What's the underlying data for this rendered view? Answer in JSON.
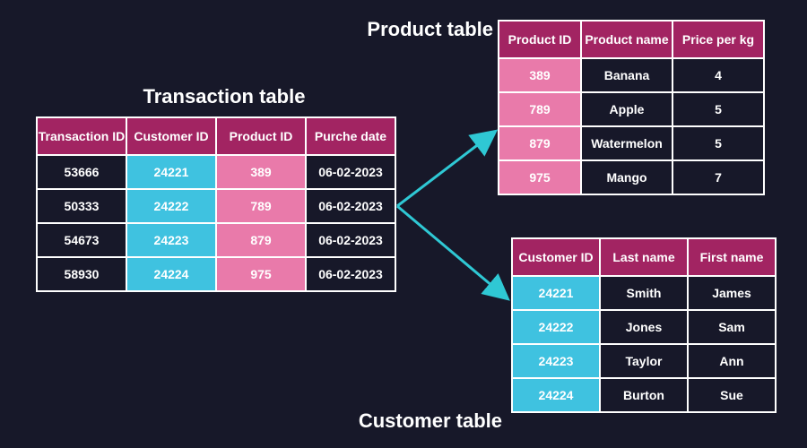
{
  "colors": {
    "bg": "#171829",
    "header": "#a22462",
    "hl_blue": "#3fc2e0",
    "hl_pink": "#e97aaa",
    "arrow": "#2fc8d4"
  },
  "transaction": {
    "title": "Transaction table",
    "columns": [
      "Transaction ID",
      "Customer ID",
      "Product ID",
      "Purche date"
    ],
    "rows": [
      [
        "53666",
        "24221",
        "389",
        "06-02-2023"
      ],
      [
        "50333",
        "24222",
        "789",
        "06-02-2023"
      ],
      [
        "54673",
        "24223",
        "879",
        "06-02-2023"
      ],
      [
        "58930",
        "24224",
        "975",
        "06-02-2023"
      ]
    ],
    "highlight_cols": {
      "1": "blue",
      "2": "pink"
    }
  },
  "product": {
    "title": "Product table",
    "columns": [
      "Product ID",
      "Product name",
      "Price per kg"
    ],
    "rows": [
      [
        "389",
        "Banana",
        "4"
      ],
      [
        "789",
        "Apple",
        "5"
      ],
      [
        "879",
        "Watermelon",
        "5"
      ],
      [
        "975",
        "Mango",
        "7"
      ]
    ],
    "highlight_cols": {
      "0": "pink"
    }
  },
  "customer": {
    "title": "Customer table",
    "columns": [
      "Customer ID",
      "Last name",
      "First name"
    ],
    "rows": [
      [
        "24221",
        "Smith",
        "James"
      ],
      [
        "24222",
        "Jones",
        "Sam"
      ],
      [
        "24223",
        "Taylor",
        "Ann"
      ],
      [
        "24224",
        "Burton",
        "Sue"
      ]
    ],
    "highlight_cols": {
      "0": "blue"
    }
  }
}
